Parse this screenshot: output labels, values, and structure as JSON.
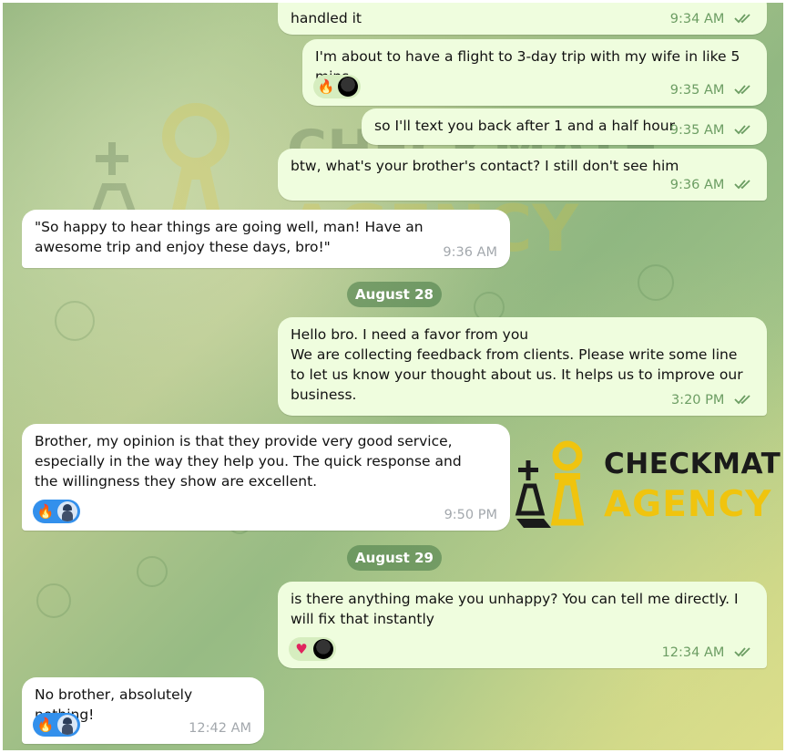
{
  "colors": {
    "outgoing_bubble": "#effdde",
    "incoming_bubble": "#ffffff",
    "time_outgoing": "#6c9d63",
    "time_incoming": "#a3a8ad",
    "reaction_incoming": "#3390ec",
    "date_pill": "#5e8e5e"
  },
  "watermark": {
    "line1": "CHECKMATE",
    "line2": "AGENCY"
  },
  "messages": [
    {
      "text": "handled it",
      "time": "9:34 AM"
    },
    {
      "text": "I'm about to have a flight to 3-day trip with my wife in like 5 mins",
      "time": "9:35 AM",
      "reactions": [
        "🔥",
        "black-avatar"
      ]
    },
    {
      "text": "so I'll text you back after 1 and a half hour",
      "time": "9:35 AM"
    },
    {
      "text": "btw, what's your brother's contact? I still don't see him",
      "time": "9:36 AM"
    },
    {
      "text": "\"So happy to hear things are going well, man! Have an awesome trip and enjoy these days, bro!\"",
      "time": "9:36 AM"
    },
    {
      "text": "Hello bro. I need a favor from you\nWe are collecting feedback from clients. Please write some line to let us know your thought about us. It helps us to improve our business.",
      "time": "3:20 PM"
    },
    {
      "text": "Brother, my opinion is that they provide very good service, especially in the way they help you. The quick response and the willingness they show are excellent.",
      "time": "9:50 PM",
      "reactions": [
        "🔥",
        "police-avatar"
      ]
    },
    {
      "text": "is there anything make you unhappy? You can tell me directly. I will fix that instantly",
      "time": "12:34 AM",
      "reactions": [
        "♥",
        "black-avatar"
      ]
    },
    {
      "text": "No brother, absolutely nothing!",
      "time": "12:42 AM",
      "reactions": [
        "🔥",
        "police-avatar"
      ]
    }
  ],
  "dates": [
    "August 28",
    "August 29"
  ]
}
